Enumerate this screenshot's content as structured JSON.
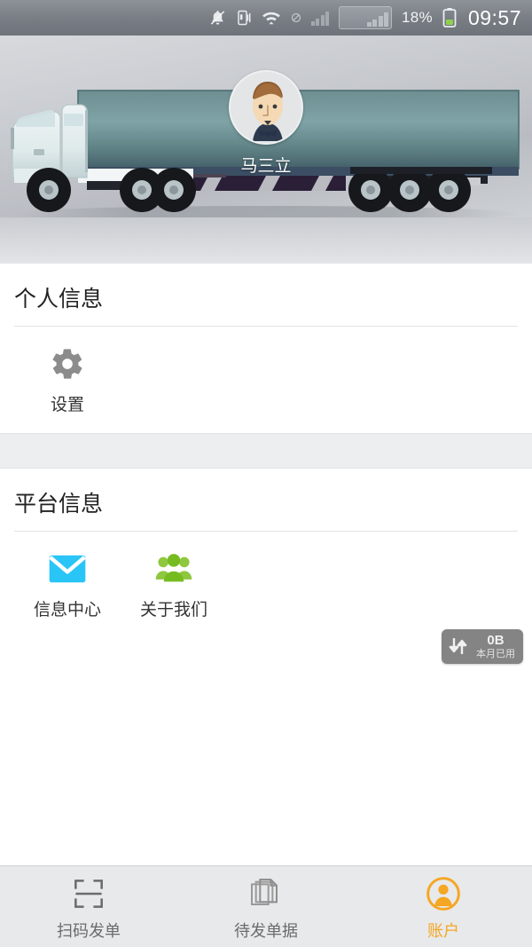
{
  "status_bar": {
    "icons": [
      "bell-muted-icon",
      "vibrate-icon",
      "wifi-icon",
      "no-sim-icon",
      "signal-icon",
      "signal-box-icon"
    ],
    "battery_percent": "18%",
    "time": "09:57"
  },
  "hero": {
    "banner_image": "truck-trailer-photo",
    "avatar": "user-avatar-cartoon-man",
    "user_name": "马三立"
  },
  "sections": [
    {
      "id": "personal-info",
      "title": "个人信息",
      "tiles": [
        {
          "id": "settings",
          "icon": "gear-icon",
          "label": "设置",
          "color": "#8c8c8c"
        }
      ]
    },
    {
      "id": "platform-info",
      "title": "平台信息",
      "tiles": [
        {
          "id": "message-center",
          "icon": "envelope-icon",
          "label": "信息中心",
          "color": "#29c5f6"
        },
        {
          "id": "about-us",
          "icon": "people-group-icon",
          "label": "关于我们",
          "color": "#76bc21"
        }
      ]
    }
  ],
  "data_chip": {
    "icon": "data-transfer-arrows-icon",
    "value": "0B",
    "sublabel": "本月已用"
  },
  "tabbar": {
    "tabs": [
      {
        "id": "scan",
        "icon": "scan-frame-icon",
        "label": "扫码发单",
        "active": false
      },
      {
        "id": "pending-docs",
        "icon": "documents-stack-icon",
        "label": "待发单据",
        "active": false
      },
      {
        "id": "account",
        "icon": "account-person-icon",
        "label": "账户",
        "active": true
      }
    ],
    "active_color": "#f5a623",
    "inactive_color": "#6b6b6b"
  }
}
